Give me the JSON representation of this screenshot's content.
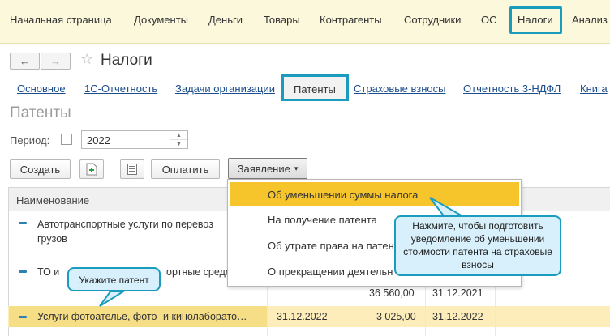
{
  "top_menu": {
    "items": [
      "Начальная страница",
      "Документы",
      "Деньги",
      "Товары",
      "Контрагенты",
      "Сотрудники",
      "ОС",
      "Налоги",
      "Анализ"
    ]
  },
  "header": {
    "title": "Налоги",
    "back_glyph": "←",
    "forward_glyph": "→",
    "star_glyph": "☆"
  },
  "links": [
    "Основное",
    "1С-Отчетность",
    "Задачи организации",
    "Патенты",
    "Страховые взносы",
    "Отчетность 3-НДФЛ",
    "Книга"
  ],
  "section_title": "Патенты",
  "period": {
    "label": "Период:",
    "year": "2022"
  },
  "toolbar": {
    "create_label": "Создать",
    "pay_label": "Оплатить",
    "statement_label": "Заявление",
    "statement_arrow": "▾"
  },
  "table": {
    "header_name": "Наименование",
    "rows": [
      {
        "line1": "Автотранспортные услуги по перевоз",
        "line2": "грузов"
      },
      {
        "line1": "ТО и",
        "line1b": "ортные средс"
      },
      {
        "sum": "36 560,00",
        "date2": "31.12.2021"
      },
      {
        "name": "Услуги фотоателье, фото- и кинолаборато…",
        "date1": "31.12.2022",
        "sum": "3 025,00",
        "date2": "31.12.2022"
      }
    ]
  },
  "dropdown": {
    "items": [
      "Об уменьшении суммы налога",
      "На получение патента",
      "Об утрате права на патен",
      "О прекращении деятельн"
    ]
  },
  "callouts": {
    "right": "Нажмите, чтобы подготовить уведомление об уменьшении стоимости патента на страховые взносы",
    "left": "Укажите патент"
  },
  "colors": {
    "accent_border": "#1a9cbf",
    "callout_fill": "#d8f0fb",
    "menu_bg": "#fbf8dc",
    "highlight_item": "#f5c52b",
    "selected_row": "#fcedbb"
  }
}
